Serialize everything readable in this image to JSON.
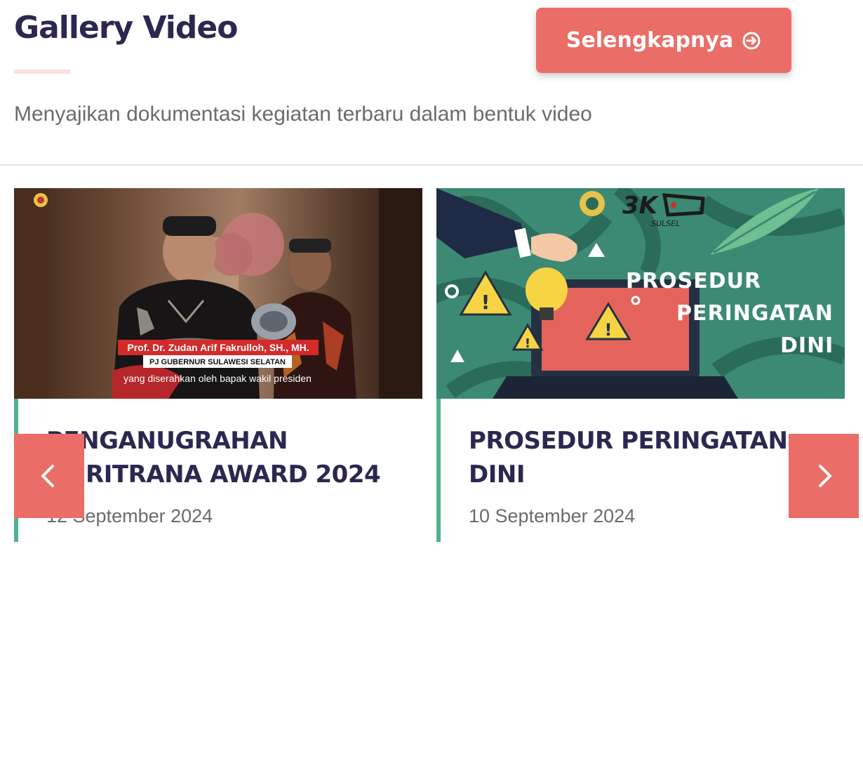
{
  "section": {
    "title": "Gallery Video",
    "subtitle": "Menyajikan dokumentasi kegiatan terbaru dalam bentuk video",
    "more_label": "Selengkapnya"
  },
  "icons": {
    "more": "arrow-circle-right-icon",
    "prev": "chevron-left-icon",
    "next": "chevron-right-icon"
  },
  "colors": {
    "title": "#2b2850",
    "accent": "#ea6e67",
    "card_border": "#4fb48c",
    "muted_text": "#6b6b6b"
  },
  "videos": [
    {
      "title": "PENGANUGRAHAN MERITRANA AWARD 2024",
      "date": "12 September 2024",
      "thumbnail": {
        "caption_name": "Prof. Dr. Zudan Arif Fakrulloh, SH., MH.",
        "caption_role": "PJ GUBERNUR SULAWESI SELATAN",
        "caption_subtitle": "yang diserahkan oleh bapak wakil presiden"
      }
    },
    {
      "title": "PROSEDUR PERINGATAN DINI",
      "date": "10 September 2024",
      "thumbnail": {
        "line1": "PROSEDUR",
        "line2": "PERINGATAN",
        "line3": "DINI",
        "logo_text": "SULSEL"
      }
    }
  ]
}
